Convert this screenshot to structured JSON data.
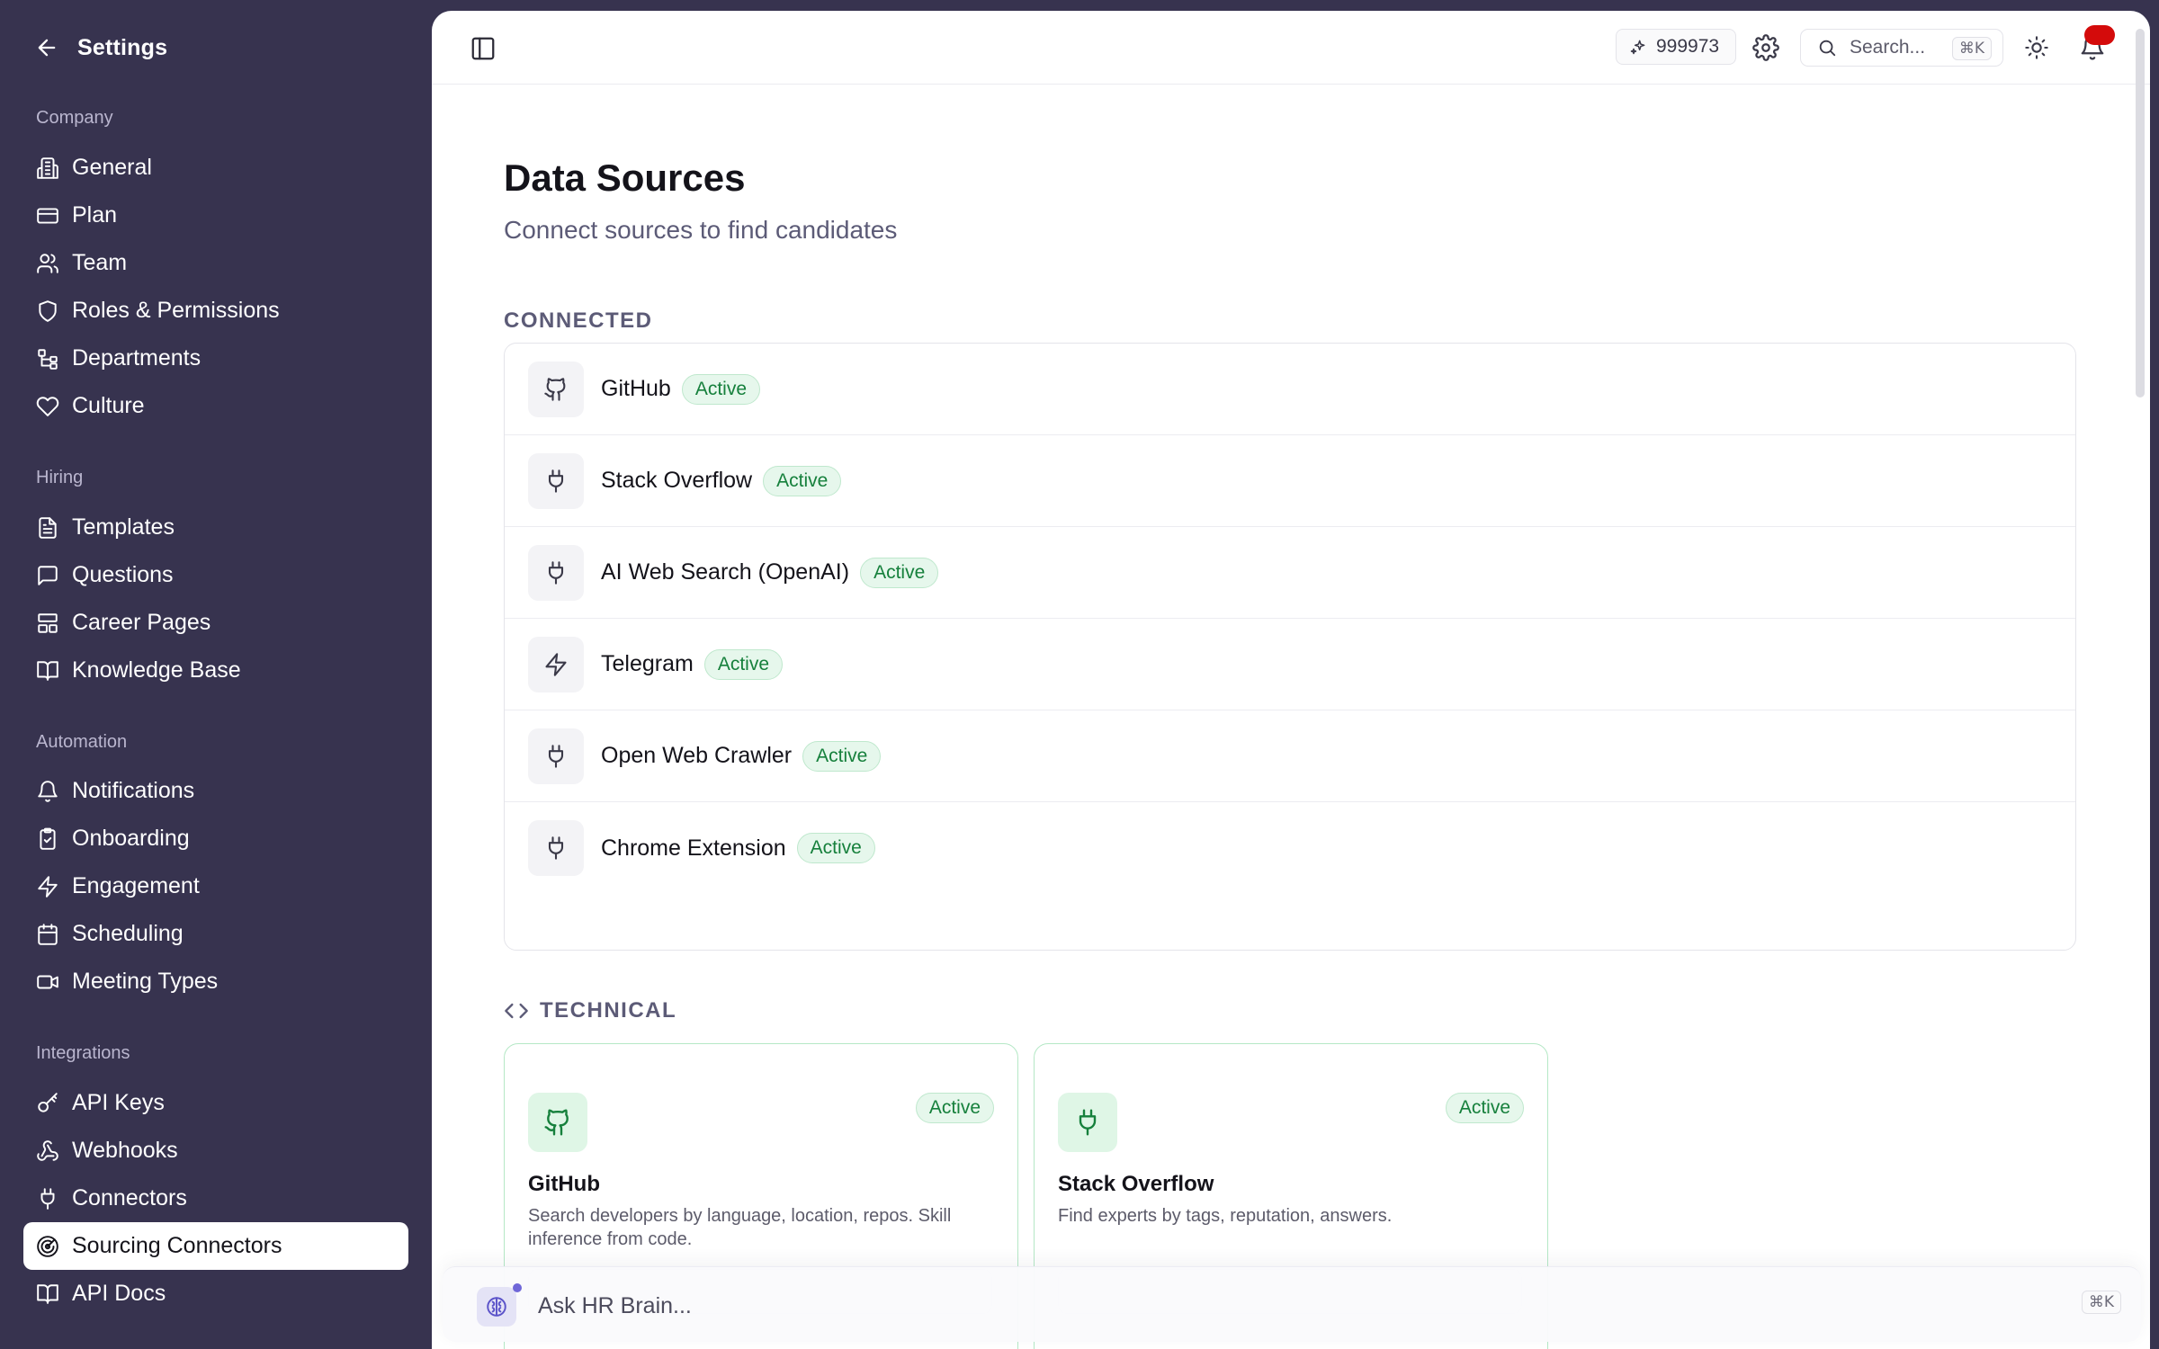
{
  "sidebar": {
    "title": "Settings",
    "groups": [
      {
        "label": "Company",
        "items": [
          {
            "label": "General",
            "icon": "building-icon"
          },
          {
            "label": "Plan",
            "icon": "credit-card-icon"
          },
          {
            "label": "Team",
            "icon": "users-icon"
          },
          {
            "label": "Roles & Permissions",
            "icon": "shield-icon"
          },
          {
            "label": "Departments",
            "icon": "hierarchy-icon"
          },
          {
            "label": "Culture",
            "icon": "heart-icon"
          }
        ]
      },
      {
        "label": "Hiring",
        "items": [
          {
            "label": "Templates",
            "icon": "file-text-icon"
          },
          {
            "label": "Questions",
            "icon": "message-square-icon"
          },
          {
            "label": "Career Pages",
            "icon": "layout-icon"
          },
          {
            "label": "Knowledge Base",
            "icon": "book-open-icon"
          }
        ]
      },
      {
        "label": "Automation",
        "items": [
          {
            "label": "Notifications",
            "icon": "bell-icon"
          },
          {
            "label": "Onboarding",
            "icon": "clipboard-check-icon"
          },
          {
            "label": "Engagement",
            "icon": "zap-icon"
          },
          {
            "label": "Scheduling",
            "icon": "calendar-icon"
          },
          {
            "label": "Meeting Types",
            "icon": "video-icon"
          }
        ]
      },
      {
        "label": "Integrations",
        "items": [
          {
            "label": "API Keys",
            "icon": "key-icon"
          },
          {
            "label": "Webhooks",
            "icon": "webhook-icon"
          },
          {
            "label": "Connectors",
            "icon": "plug-icon"
          },
          {
            "label": "Sourcing Connectors",
            "icon": "radar-icon",
            "active": true
          },
          {
            "label": "API Docs",
            "icon": "book-open-icon"
          }
        ]
      }
    ]
  },
  "topbar": {
    "credits": "999973",
    "search_placeholder": "Search...",
    "search_shortcut": "⌘K"
  },
  "page": {
    "title": "Data Sources",
    "subtitle": "Connect sources to find candidates"
  },
  "connected": {
    "label": "CONNECTED",
    "rows": [
      {
        "name": "GitHub",
        "status": "Active",
        "icon": "github-icon"
      },
      {
        "name": "Stack Overflow",
        "status": "Active",
        "icon": "plug-icon"
      },
      {
        "name": "AI Web Search (OpenAI)",
        "status": "Active",
        "icon": "plug-icon"
      },
      {
        "name": "Telegram",
        "status": "Active",
        "icon": "zap-icon"
      },
      {
        "name": "Open Web Crawler",
        "status": "Active",
        "icon": "plug-icon"
      },
      {
        "name": "Chrome Extension",
        "status": "Active",
        "icon": "plug-icon"
      }
    ]
  },
  "technical": {
    "label": "TECHNICAL",
    "cards": [
      {
        "title": "GitHub",
        "status": "Active",
        "description": "Search developers by language, location, repos. Skill inference from code.",
        "icon": "github-icon"
      },
      {
        "title": "Stack Overflow",
        "status": "Active",
        "description": "Find experts by tags, reputation, answers.",
        "icon": "plug-icon"
      }
    ]
  },
  "ask": {
    "placeholder": "Ask HR Brain...",
    "shortcut": "⌘K"
  },
  "colors": {
    "sidebar_bg": "#37334f",
    "active_badge_bg": "#e6f7ec",
    "active_badge_text": "#16803c",
    "notification_badge": "#d40b0b",
    "accent": "#6f66d8"
  }
}
